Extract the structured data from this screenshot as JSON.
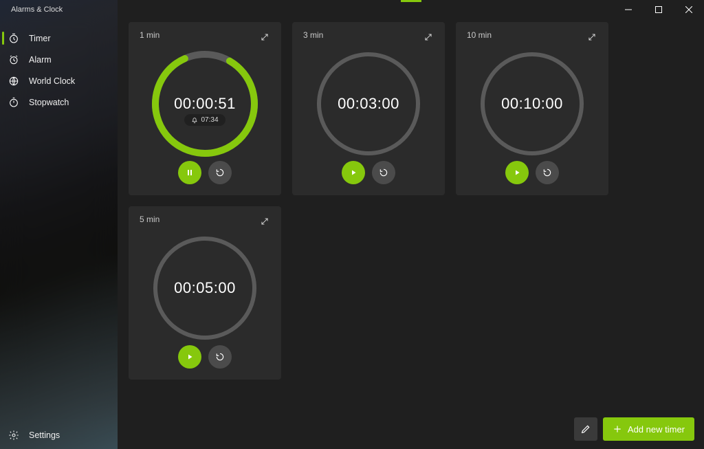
{
  "app_title": "Alarms & Clock",
  "colors": {
    "accent": "#86c80d",
    "track": "#5a5a5a",
    "card": "#2b2b2b"
  },
  "nav": [
    {
      "id": "timer",
      "label": "Timer",
      "active": true
    },
    {
      "id": "alarm",
      "label": "Alarm",
      "active": false
    },
    {
      "id": "world",
      "label": "World Clock",
      "active": false
    },
    {
      "id": "stopwatch",
      "label": "Stopwatch",
      "active": false
    }
  ],
  "settings_label": "Settings",
  "timers": [
    {
      "title": "1 min",
      "time": "00:00:51",
      "progress": 0.85,
      "running": true,
      "alarm_at": "07:34"
    },
    {
      "title": "3 min",
      "time": "00:03:00",
      "progress": 0.0,
      "running": false
    },
    {
      "title": "10 min",
      "time": "00:10:00",
      "progress": 0.0,
      "running": false
    },
    {
      "title": "5 min",
      "time": "00:05:00",
      "progress": 0.0,
      "running": false
    }
  ],
  "buttons": {
    "add_timer": "Add new timer"
  }
}
